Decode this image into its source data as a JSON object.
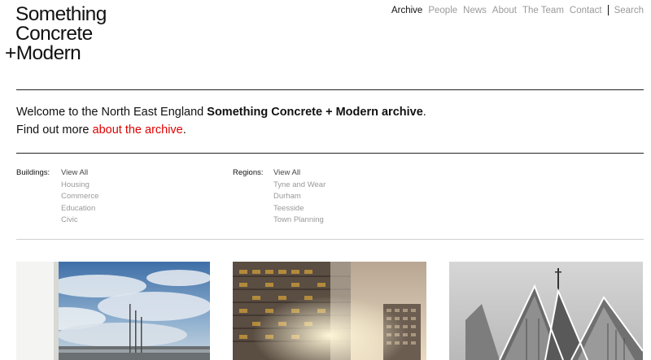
{
  "logo": {
    "line1": "Something",
    "line2": "Concrete",
    "line3": "+Modern"
  },
  "nav": {
    "items": [
      {
        "label": "Archive",
        "active": true
      },
      {
        "label": "People",
        "active": false
      },
      {
        "label": "News",
        "active": false
      },
      {
        "label": "About",
        "active": false
      },
      {
        "label": "The Team",
        "active": false
      },
      {
        "label": "Contact",
        "active": false
      }
    ],
    "search_label": "Search"
  },
  "intro": {
    "prefix": "Welcome to the North East England ",
    "bold": "Something Concrete + Modern archive",
    "suffix": ".",
    "line2_prefix": "Find out more ",
    "line2_link": "about the archive",
    "line2_suffix": "."
  },
  "filters": {
    "buildings": {
      "label": "Buildings:",
      "items": [
        "View All",
        "Housing",
        "Commerce",
        "Education",
        "Civic"
      ]
    },
    "regions": {
      "label": "Regions:",
      "items": [
        "View All",
        "Tyne and Wear",
        "Durham",
        "Teesside",
        "Town Planning"
      ]
    }
  },
  "colors": {
    "accent_red": "#e00000",
    "muted_gray": "#999999",
    "text": "#111111"
  },
  "cards": [
    {
      "image": "building-photo-sky-flagpoles"
    },
    {
      "image": "building-photo-tower-blocks"
    },
    {
      "image": "building-photo-church-bw"
    }
  ]
}
